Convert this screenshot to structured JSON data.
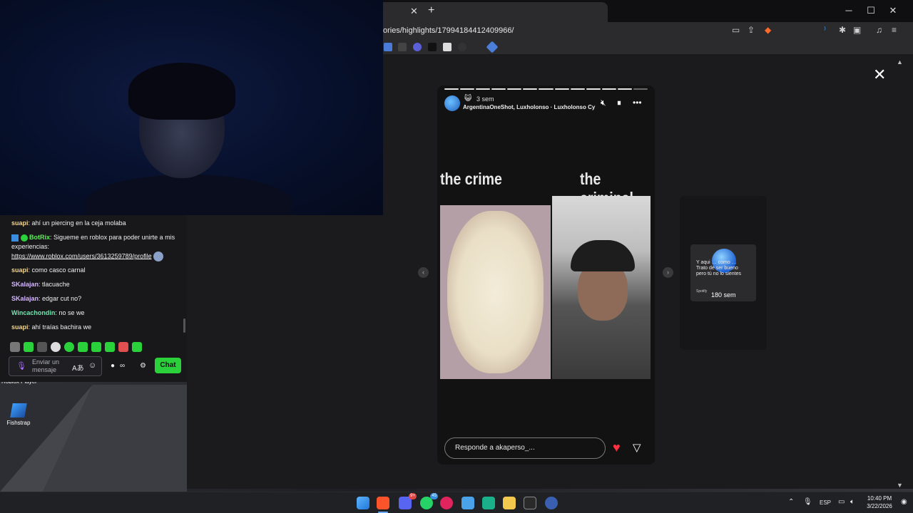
{
  "browser": {
    "url": "ories/highlights/17994184412409966/",
    "tab_close": "✕",
    "new_tab": "+",
    "minimize": "─",
    "maximize": "☐",
    "close": "✕"
  },
  "story": {
    "time": "3 sem",
    "cat_emoji": "😺",
    "music": "ArgentinaOneShot, Luxholonso · Luxholonso Cy",
    "text_left": "the crime",
    "text_right": "the criminal",
    "reply_placeholder": "Responde a akaperso_...",
    "close": "✕",
    "prev": "‹",
    "next": "›"
  },
  "preview": {
    "snippet": "Y aqui … como … Trato de ser bueno pero tú no lo sientes",
    "brand": "Spotify",
    "time": "180 sem"
  },
  "chat": {
    "messages": [
      {
        "user": "suapi",
        "color": "#f3d58a",
        "text": "ahí un piercing en la ceja molaba"
      },
      {
        "user": "BotRix",
        "color": "#5df05a",
        "text": "Sigueme en roblox para poder unirte a mis experiencias:",
        "link": "https://www.roblox.com/users/3613259789/profile"
      },
      {
        "user": "suapi",
        "color": "#f3d58a",
        "text": "como casco carnal"
      },
      {
        "user": "SKalajan",
        "color": "#d5b5ff",
        "text": "tlacuache"
      },
      {
        "user": "SKalajan",
        "color": "#d5b5ff",
        "text": "edgar cut no?"
      },
      {
        "user": "Wincachondin",
        "color": "#6fe6b0",
        "text": "no se we"
      },
      {
        "user": "suapi",
        "color": "#f3d58a",
        "text": "ahí traías bachira we"
      }
    ],
    "placeholder_line1": "Enviar un",
    "placeholder_line2": "mensaje",
    "chat_button": "Chat",
    "points": "∞"
  },
  "desktop": {
    "icon1_label": "Roblox Player",
    "icon2_label": "Fishstrap"
  },
  "taskbar": {
    "language": "ESP",
    "time": "10:40 PM",
    "date": "3/22/2026",
    "discord_badge": "9+",
    "whatsapp_badge": "45"
  }
}
